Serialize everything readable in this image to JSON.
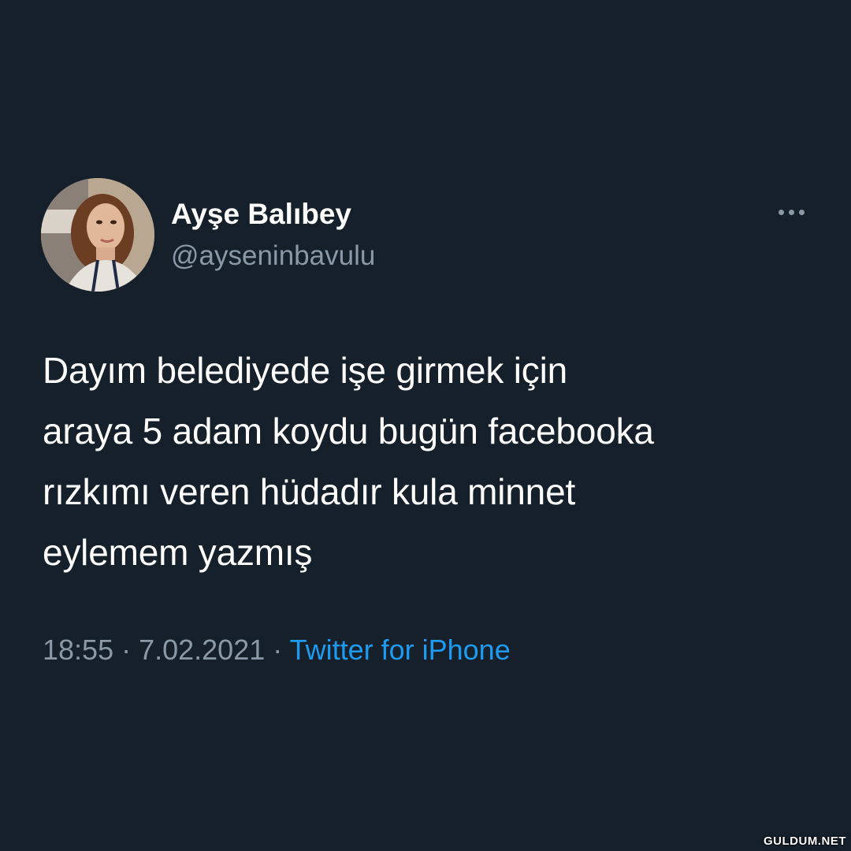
{
  "colors": {
    "background": "#15202b",
    "primary_text": "#ffffff",
    "secondary_text": "#8b98a5",
    "link": "#1d9bf0"
  },
  "author": {
    "display_name": "Ayşe Balıbey",
    "handle": "@ayseninbavulu",
    "avatar_icon": "profile-photo"
  },
  "menu": {
    "icon": "more-horizontal-icon"
  },
  "tweet": {
    "lines": [
      "Dayım belediyede işe girmek için",
      "araya 5 adam koydu bugün facebooka",
      "rızkımı veren hüdadır kula minnet",
      "eylemem yazmış"
    ]
  },
  "meta": {
    "time": "18:55",
    "separator": " · ",
    "date": "7.02.2021",
    "source": "Twitter for iPhone"
  },
  "watermark": "GULDUM.NET"
}
